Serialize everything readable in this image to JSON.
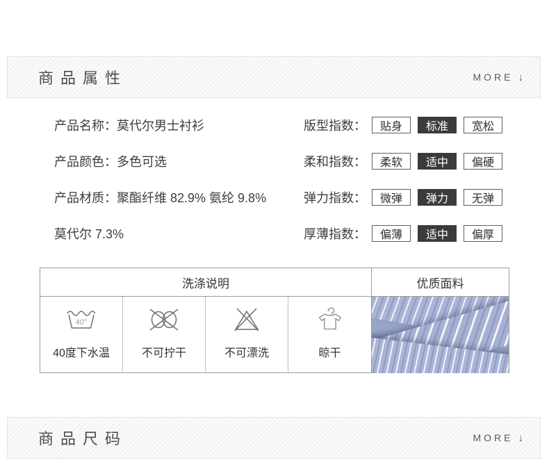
{
  "attribute_section": {
    "title": "商品属性",
    "more": "MORE",
    "arrow": "↓"
  },
  "size_section": {
    "title": "商品尺码",
    "more": "MORE",
    "arrow": "↓"
  },
  "product_info": {
    "rows": [
      {
        "label": "产品名称：",
        "value": "莫代尔男士衬衫"
      },
      {
        "label": "产品颜色：",
        "value": "多色可选"
      },
      {
        "label": "产品材质：",
        "value": "聚酯纤维 82.9% 氨纶 9.8%"
      },
      {
        "label": "",
        "value": "莫代尔 7.3%"
      }
    ]
  },
  "indexes": [
    {
      "label": "版型指数：",
      "options": [
        "贴身",
        "标准",
        "宽松"
      ],
      "selected": 1
    },
    {
      "label": "柔和指数：",
      "options": [
        "柔软",
        "适中",
        "偏硬"
      ],
      "selected": 1
    },
    {
      "label": "弹力指数：",
      "options": [
        "微弹",
        "弹力",
        "无弹"
      ],
      "selected": 1
    },
    {
      "label": "厚薄指数：",
      "options": [
        "偏薄",
        "适中",
        "偏厚"
      ],
      "selected": 1
    }
  ],
  "care_table": {
    "wash_title": "洗涤说明",
    "fabric_title": "优质面料",
    "wash_items": [
      {
        "icon": "wash-temp-40-icon",
        "temp": "40°",
        "label": "40度下水温"
      },
      {
        "icon": "no-wring-icon",
        "label": "不可拧干"
      },
      {
        "icon": "no-bleach-icon",
        "label": "不可漂洗"
      },
      {
        "icon": "hang-dry-icon",
        "label": "晾干"
      }
    ]
  },
  "colors": {
    "selected_box_bg": "#3b3b3b",
    "selected_box_text": "#ffffff",
    "header_stripe_bg": "#fafafa",
    "fabric_base": "#a7b1d3",
    "fabric_stripe": "#f3f5fa"
  }
}
